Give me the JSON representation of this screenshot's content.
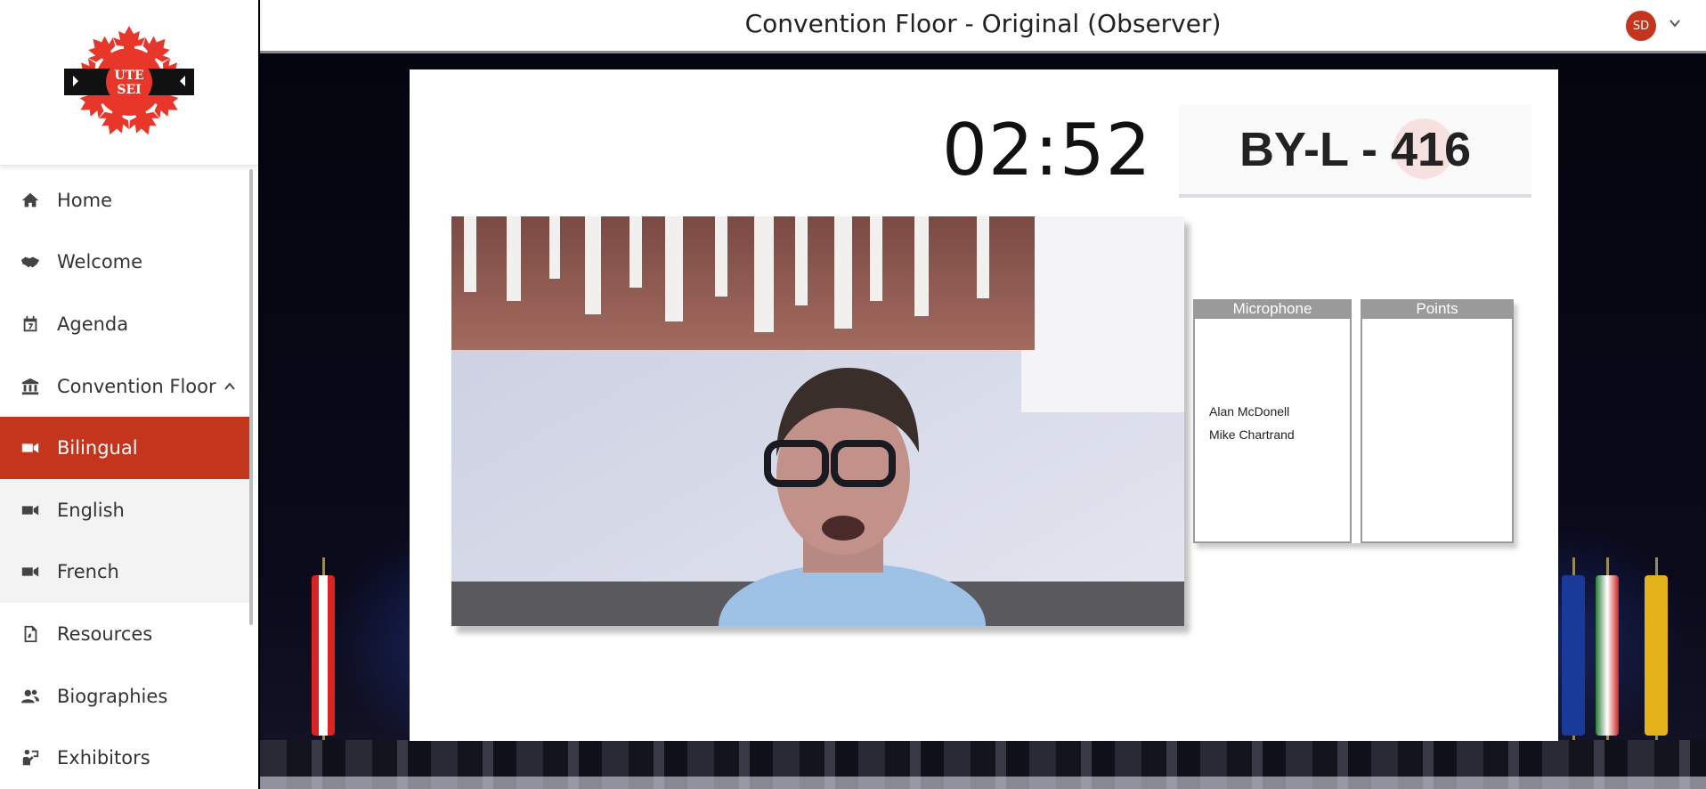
{
  "app": {
    "logo_text_top": "UTE",
    "logo_text_bottom": "SEI"
  },
  "header": {
    "title": "Convention Floor - Original (Observer)",
    "user_initials": "SD"
  },
  "sidebar": {
    "items": [
      {
        "label": "Home",
        "icon": "home-icon"
      },
      {
        "label": "Welcome",
        "icon": "handshake-icon"
      },
      {
        "label": "Agenda",
        "icon": "calendar-icon"
      },
      {
        "label": "Convention Floor",
        "icon": "bank-icon",
        "expanded": true
      },
      {
        "label": "Bilingual",
        "icon": "video-camera-icon",
        "active": true
      },
      {
        "label": "English",
        "icon": "video-camera-icon"
      },
      {
        "label": "French",
        "icon": "video-camera-icon"
      },
      {
        "label": "Resources",
        "icon": "pdf-file-icon"
      },
      {
        "label": "Biographies",
        "icon": "users-icon"
      },
      {
        "label": "Exhibitors",
        "icon": "presenter-icon"
      }
    ]
  },
  "stream": {
    "timer": "02:52",
    "bylaw_label": "BY-L - 416",
    "queue": {
      "microphone_header": "Microphone",
      "points_header": "Points",
      "microphone_names": [
        "Alan McDonell",
        "Mike Chartrand"
      ]
    }
  },
  "colors": {
    "accent": "#c4351e",
    "queue_header": "#9a9a9a"
  }
}
